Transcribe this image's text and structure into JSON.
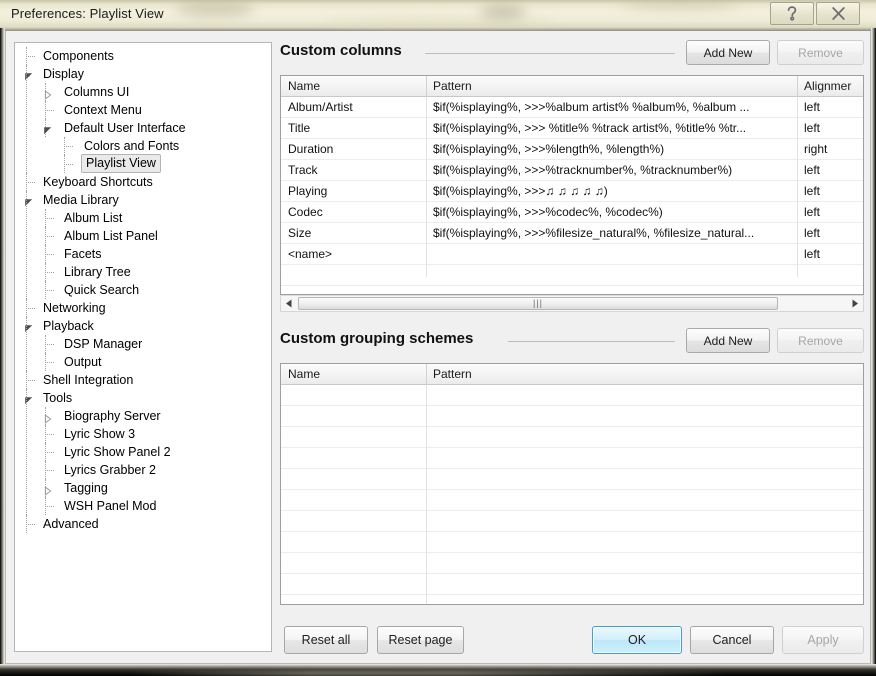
{
  "window": {
    "title": "Preferences: Playlist View",
    "help_button": "?",
    "close_button": "X"
  },
  "tree": {
    "items": [
      {
        "label": "Components",
        "depth": 0,
        "toggle": "none",
        "selected": false
      },
      {
        "label": "Display",
        "depth": 0,
        "toggle": "expanded",
        "selected": false
      },
      {
        "label": "Columns UI",
        "depth": 1,
        "toggle": "collapsed",
        "selected": false
      },
      {
        "label": "Context Menu",
        "depth": 1,
        "toggle": "none",
        "selected": false
      },
      {
        "label": "Default User Interface",
        "depth": 1,
        "toggle": "expanded",
        "selected": false
      },
      {
        "label": "Colors and Fonts",
        "depth": 2,
        "toggle": "none",
        "selected": false
      },
      {
        "label": "Playlist View",
        "depth": 2,
        "toggle": "none",
        "selected": true
      },
      {
        "label": "Keyboard Shortcuts",
        "depth": 0,
        "toggle": "none",
        "selected": false
      },
      {
        "label": "Media Library",
        "depth": 0,
        "toggle": "expanded",
        "selected": false
      },
      {
        "label": "Album List",
        "depth": 1,
        "toggle": "none",
        "selected": false
      },
      {
        "label": "Album List Panel",
        "depth": 1,
        "toggle": "none",
        "selected": false
      },
      {
        "label": "Facets",
        "depth": 1,
        "toggle": "none",
        "selected": false
      },
      {
        "label": "Library Tree",
        "depth": 1,
        "toggle": "none",
        "selected": false
      },
      {
        "label": "Quick Search",
        "depth": 1,
        "toggle": "none",
        "selected": false
      },
      {
        "label": "Networking",
        "depth": 0,
        "toggle": "none",
        "selected": false
      },
      {
        "label": "Playback",
        "depth": 0,
        "toggle": "expanded",
        "selected": false
      },
      {
        "label": "DSP Manager",
        "depth": 1,
        "toggle": "none",
        "selected": false
      },
      {
        "label": "Output",
        "depth": 1,
        "toggle": "none",
        "selected": false
      },
      {
        "label": "Shell Integration",
        "depth": 0,
        "toggle": "none",
        "selected": false
      },
      {
        "label": "Tools",
        "depth": 0,
        "toggle": "expanded",
        "selected": false
      },
      {
        "label": "Biography Server",
        "depth": 1,
        "toggle": "collapsed",
        "selected": false
      },
      {
        "label": "Lyric Show 3",
        "depth": 1,
        "toggle": "none",
        "selected": false
      },
      {
        "label": "Lyric Show Panel 2",
        "depth": 1,
        "toggle": "none",
        "selected": false
      },
      {
        "label": "Lyrics Grabber 2",
        "depth": 1,
        "toggle": "none",
        "selected": false
      },
      {
        "label": "Tagging",
        "depth": 1,
        "toggle": "collapsed",
        "selected": false
      },
      {
        "label": "WSH Panel Mod",
        "depth": 1,
        "toggle": "none",
        "selected": false
      },
      {
        "label": "Advanced",
        "depth": 0,
        "toggle": "none",
        "selected": false
      }
    ]
  },
  "custom_columns": {
    "title": "Custom columns",
    "add_new_label": "Add New",
    "remove_label": "Remove",
    "headers": [
      "Name",
      "Pattern",
      "Alignmer"
    ],
    "rows": [
      {
        "name": "Album/Artist",
        "pattern": "$if(%isplaying%, >>>%album artist% %album%, %album ...",
        "alignment": "left"
      },
      {
        "name": "Title",
        "pattern": "$if(%isplaying%, >>> %title% %track artist%, %title% %tr...",
        "alignment": "left"
      },
      {
        "name": "Duration",
        "pattern": "$if(%isplaying%, >>>%length%, %length%)",
        "alignment": "right"
      },
      {
        "name": "Track",
        "pattern": "$if(%isplaying%, >>>%tracknumber%, %tracknumber%)",
        "alignment": "left"
      },
      {
        "name": "Playing",
        "pattern": " $if(%isplaying%, >>>♫ ♫ ♫ ♫ ♫)",
        "alignment": "left"
      },
      {
        "name": "Codec",
        "pattern": "$if(%isplaying%, >>>%codec%, %codec%)",
        "alignment": "left"
      },
      {
        "name": "Size",
        "pattern": "$if(%isplaying%, >>>%filesize_natural%, %filesize_natural...",
        "alignment": "left"
      },
      {
        "name": "<name>",
        "pattern": "",
        "alignment": "left"
      },
      {
        "name": "",
        "pattern": "",
        "alignment": ""
      }
    ],
    "scrollbar": {
      "left_arrow": "◀",
      "right_arrow": "▶",
      "grip": "|||"
    }
  },
  "custom_grouping": {
    "title": "Custom grouping schemes",
    "add_new_label": "Add New",
    "remove_label": "Remove",
    "headers": [
      "Name",
      "Pattern"
    ],
    "rows": [
      {
        "name": "",
        "pattern": ""
      },
      {
        "name": "",
        "pattern": ""
      },
      {
        "name": "",
        "pattern": ""
      },
      {
        "name": "",
        "pattern": ""
      },
      {
        "name": "",
        "pattern": ""
      },
      {
        "name": "",
        "pattern": ""
      },
      {
        "name": "",
        "pattern": ""
      },
      {
        "name": "",
        "pattern": ""
      },
      {
        "name": "",
        "pattern": ""
      },
      {
        "name": "",
        "pattern": ""
      },
      {
        "name": "",
        "pattern": ""
      }
    ]
  },
  "footer": {
    "reset_all": "Reset all",
    "reset_page": "Reset page",
    "ok": "OK",
    "cancel": "Cancel",
    "apply": "Apply"
  },
  "colors": {
    "titlebar_cream": "#efecd8",
    "accent_blue": "#3c9fd6",
    "dialog_bg": "#f0f0f0",
    "table_bg": "#ffffff"
  }
}
